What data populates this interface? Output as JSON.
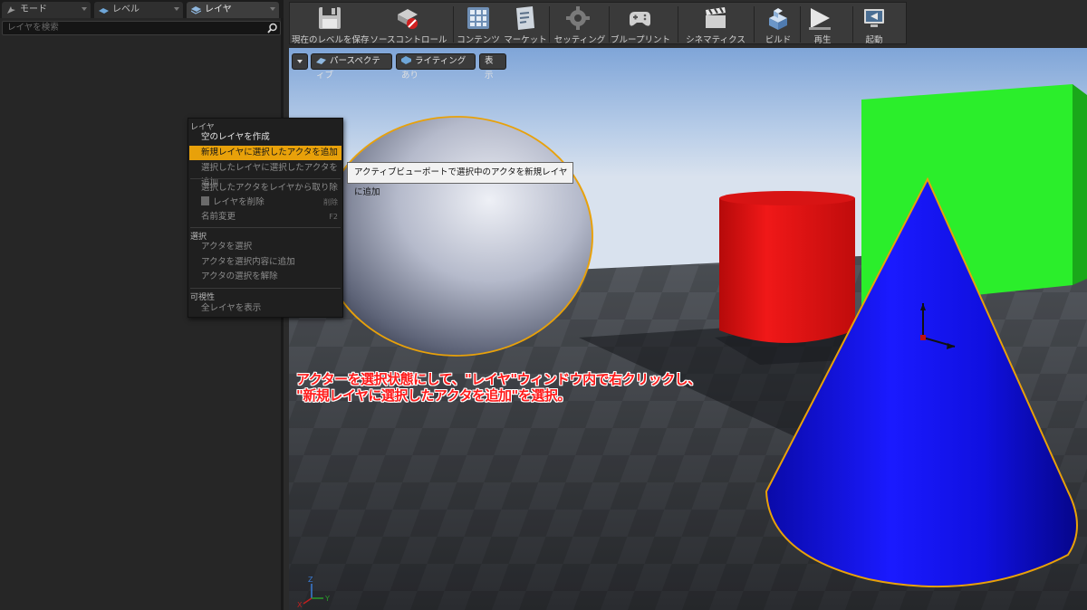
{
  "tabs": [
    {
      "label": "モード",
      "icon": "mode-icon"
    },
    {
      "label": "レベル",
      "icon": "level-icon"
    },
    {
      "label": "レイヤ",
      "icon": "layer-icon"
    }
  ],
  "search": {
    "placeholder": "レイヤを検索"
  },
  "toolbar": {
    "buttons": [
      {
        "label": "現在のレベルを保存",
        "icon": "save-icon"
      },
      {
        "label": "ソースコントロール",
        "icon": "source-control-icon"
      },
      {
        "label": "コンテンツ",
        "icon": "content-icon"
      },
      {
        "label": "マーケット",
        "icon": "marketplace-icon"
      },
      {
        "label": "セッティング",
        "icon": "settings-icon"
      },
      {
        "label": "ブループリント",
        "icon": "blueprint-icon"
      },
      {
        "label": "シネマティクス",
        "icon": "cinematics-icon"
      },
      {
        "label": "ビルド",
        "icon": "build-icon"
      },
      {
        "label": "再生",
        "icon": "play-icon"
      },
      {
        "label": "起動",
        "icon": "launch-icon"
      }
    ]
  },
  "viewport": {
    "perspective_label": "パースペクティブ",
    "lighting_label": "ライティングあり",
    "show_label": "表示",
    "axis_labels": {
      "x": "X",
      "y": "Y",
      "z": "Z"
    }
  },
  "context_menu": {
    "sections": [
      {
        "header": "レイヤ",
        "items": [
          {
            "label": "空のレイヤを作成",
            "enabled": true
          },
          {
            "label": "新規レイヤに選択したアクタを追加",
            "enabled": true,
            "highlighted": true
          },
          {
            "label": "選択したレイヤに選択したアクタを追加",
            "enabled": false
          },
          {
            "label": "選択したアクタをレイヤから取り除く",
            "enabled": false
          },
          {
            "label": "レイヤを削除",
            "enabled": false,
            "shortcut": "削除"
          },
          {
            "label": "名前変更",
            "enabled": false,
            "shortcut": "F2"
          }
        ]
      },
      {
        "header": "選択",
        "items": [
          {
            "label": "アクタを選択",
            "enabled": false
          },
          {
            "label": "アクタを選択内容に追加",
            "enabled": false
          },
          {
            "label": "アクタの選択を解除",
            "enabled": false
          }
        ]
      },
      {
        "header": "可視性",
        "items": [
          {
            "label": "全レイヤを表示",
            "enabled": false
          }
        ]
      }
    ]
  },
  "tooltip": "アクティブビューポートで選択中のアクタを新規レイヤに追加",
  "annotation": {
    "line1": "アクターを選択状態にして、\"レイヤ\"ウィンドウ内で右クリックし、",
    "line2": "\"新規レイヤに選択したアクタを追加\"を選択。"
  },
  "colors": {
    "highlight": "#e8a10a",
    "annotation": "#ff1a1a",
    "selection_outline": "#e8a10a",
    "cone": "#1010e0",
    "cylinder": "#e01010",
    "cube": "#22dd22"
  }
}
